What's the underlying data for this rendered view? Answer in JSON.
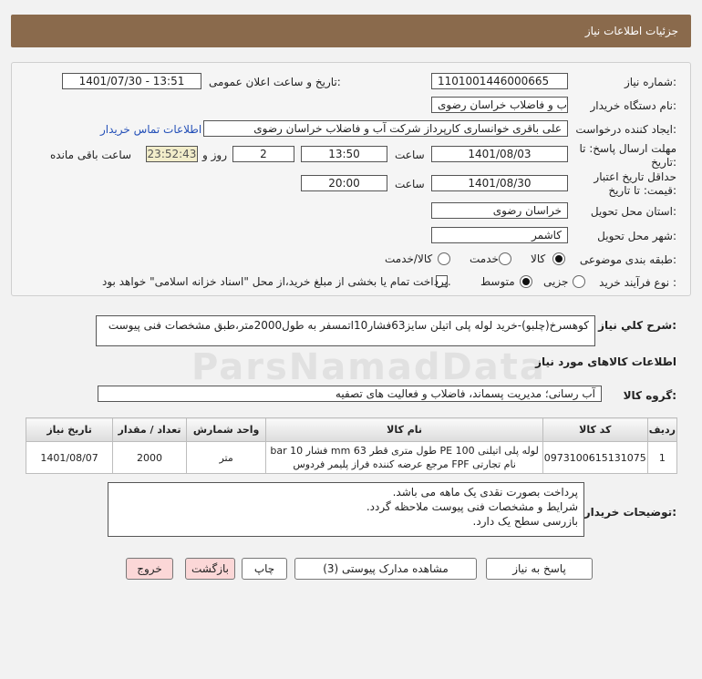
{
  "header": {
    "title": "جزئیات اطلاعات نیاز"
  },
  "form": {
    "need_number": {
      "label": "شماره نیاز:",
      "value": "1101001446000665"
    },
    "announce_date": {
      "label": "تاریخ و ساعت اعلان عمومی:",
      "value": "1401/07/30 - 13:51"
    },
    "buyer_org": {
      "label": "نام دستگاه خریدار:",
      "value": "شرکت آب و فاضلاب خراسان رضوی"
    },
    "requester": {
      "label": "ایجاد کننده درخواست:",
      "value": "علی باقری خوانساری کارپرداز شرکت آب و فاضلاب خراسان رضوی",
      "contact_link": "اطلاعات تماس خریدار"
    },
    "reply_deadline": {
      "label_line1": "مهلت ارسال پاسخ: تا",
      "label_line2": "تاریخ:",
      "date": "1401/08/03",
      "time_label": "ساعت",
      "time": "13:50",
      "days": "2",
      "days_label": "روز و",
      "remaining": "23:52:43",
      "remaining_label": "ساعت باقی مانده"
    },
    "price_validity": {
      "label_line1": "حداقل تاریخ اعتبار",
      "label_line2": "قیمت: تا تاریخ:",
      "date": "1401/08/30",
      "time_label": "ساعت",
      "time": "20:00"
    },
    "province": {
      "label": "استان محل تحویل:",
      "value": "خراسان رضوی"
    },
    "city": {
      "label": "شهر محل تحویل:",
      "value": "کاشمر"
    },
    "category": {
      "label": "طبقه بندی موضوعی:",
      "options": [
        "کالا",
        "خدمت",
        "کالا/خدمت"
      ],
      "selected": "کالا"
    },
    "purchase_type": {
      "label": "نوع فرآیند خرید :",
      "options": [
        "جزیی",
        "متوسط"
      ],
      "selected": "متوسط",
      "payment_note": "پرداخت تمام یا بخشی از مبلغ خرید،از محل \"اسناد خزانه اسلامی\" خواهد بود."
    }
  },
  "need_description": {
    "label": "شرح کلي نياز:",
    "value": "کوهسرخ(چلبو)-خرید لوله پلی اتیلن سایز63فشار10اتمسفر به طول2000متر،طبق مشخصات فنی پیوست"
  },
  "goods_info": {
    "title": "اطلاعات کالاهای مورد نیاز",
    "group_label": "گروه کالا:",
    "group_value": "آب رسانی؛ مدیریت پسماند، فاضلاب و فعالیت های تصفیه",
    "columns": [
      "ردیف",
      "کد کالا",
      "نام کالا",
      "واحد شمارش",
      "تعداد / مقدار",
      "تاریخ نیاز"
    ],
    "rows": [
      {
        "row": "1",
        "code": "0973100615131075",
        "name_line1": "لوله پلی اتیلنی PE 100 طول متری قطر 63 mm فشار 10 bar",
        "name_line2": "نام تجارتی FPF مرجع عرضه کننده فراز پلیمر فردوس",
        "unit": "متر",
        "qty": "2000",
        "date": "1401/08/07"
      }
    ]
  },
  "buyer_notes": {
    "label": "توضیحات خریدار:",
    "lines": [
      "پرداخت بصورت نقدی یک ماهه می باشد.",
      "شرایط و مشخصات فنی پیوست ملاحظه گردد.",
      "بازرسی سطح یک دارد."
    ]
  },
  "buttons": {
    "reply": "پاسخ به نیاز",
    "attachments": "مشاهده مدارک پیوستی (3)",
    "print": "چاپ",
    "back": "بازگشت",
    "exit": "خروج"
  },
  "watermark": "ParsNamadData"
}
